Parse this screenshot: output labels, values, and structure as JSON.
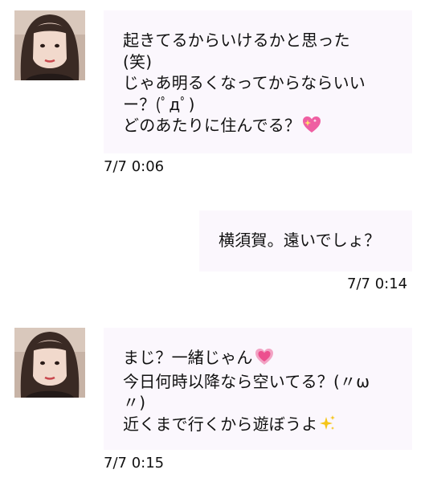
{
  "messages": [
    {
      "sender": "other",
      "lines": [
        "起きてるからいけるかと思った",
        "(笑)",
        "じゃあ明るくなってからならいい",
        "ー？(ﾟдﾟ)",
        "どのあたりに住んでる？"
      ],
      "emoji": "sparkling-heart",
      "time": "7/7 0:06"
    },
    {
      "sender": "self",
      "lines": [
        "横須賀。遠いでしょ？"
      ],
      "time": "7/7 0:14"
    },
    {
      "sender": "other",
      "lines": [
        "まじ？一緒じゃん",
        "今日何時以降なら空いてる？(〃ω",
        "〃)",
        "近くまで行くから遊ぼうよ"
      ],
      "emojis": [
        "growing-heart",
        "sparkles"
      ],
      "time": "7/7 0:15"
    }
  ],
  "colors": {
    "bubble_background": "#fbf7fd",
    "text": "#111111",
    "background": "#ffffff"
  }
}
